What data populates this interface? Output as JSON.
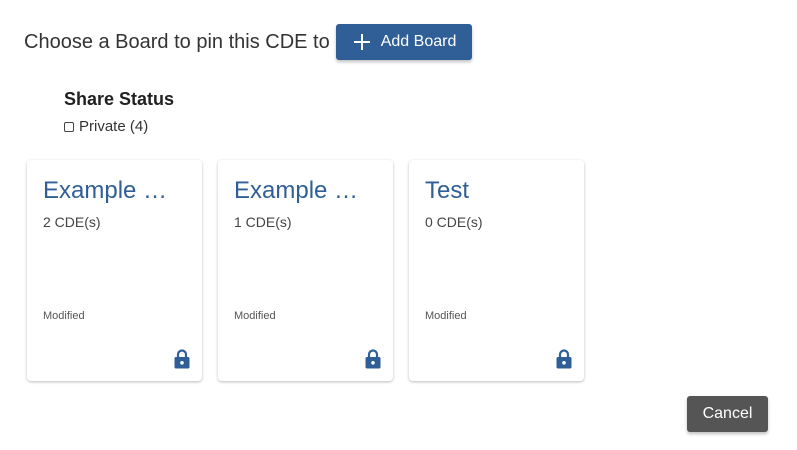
{
  "header": {
    "title": "Choose a Board to pin this CDE to",
    "add_board_label": "Add Board"
  },
  "share_status": {
    "title": "Share Status",
    "private_label": "Private (4)",
    "private_checked": false
  },
  "boards": [
    {
      "title": "Example C…",
      "count": "2 CDE(s)",
      "modified_label": "Modified",
      "icon": "lock-icon"
    },
    {
      "title": "Example C…",
      "count": "1 CDE(s)",
      "modified_label": "Modified",
      "icon": "lock-icon"
    },
    {
      "title": "Test",
      "count": "0 CDE(s)",
      "modified_label": "Modified",
      "icon": "lock-icon"
    }
  ],
  "actions": {
    "cancel_label": "Cancel"
  },
  "colors": {
    "primary": "#2f5f96",
    "cancel": "#555555"
  }
}
